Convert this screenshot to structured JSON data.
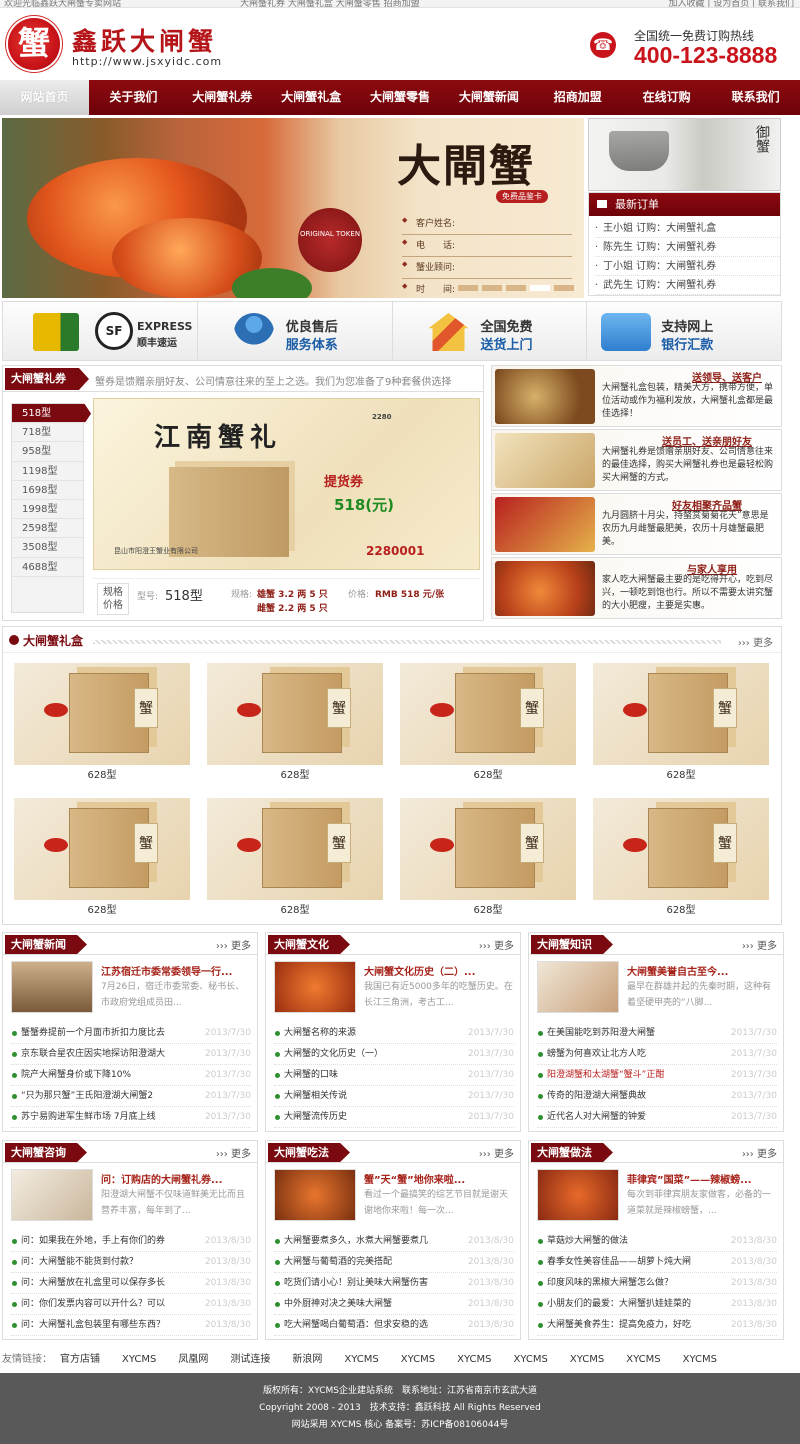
{
  "topbar": {
    "left": "欢迎光临鑫跃大闸蟹专卖网站",
    "center": "大闸蟹礼券 大闸蟹礼盒 大闸蟹零售 招商加盟",
    "right": "加入收藏 | 设为首页 | 联系我们"
  },
  "header": {
    "seal_char": "蟹",
    "logo_name": "鑫跃大闸蟹",
    "logo_url": "http://www.jsxyidc.com",
    "hotline_label": "全国统一免费订购热线",
    "hotline_number": "400-123-8888",
    "phone_icon": "phone-icon"
  },
  "nav": {
    "items": [
      "网站首页",
      "关于我们",
      "大闸蟹礼券",
      "大闸蟹礼盒",
      "大闸蟹零售",
      "大闸蟹新闻",
      "招商加盟",
      "在线订购",
      "联系我们"
    ],
    "active_index": 0
  },
  "banner": {
    "title": "大閘蟹",
    "subtitle": "免费品鉴卡",
    "seal_text": "ORIGINAL TOKEN",
    "form_fields": [
      "客户姓名:",
      "电　　话:",
      "蟹业顾问:",
      "时　　间:"
    ],
    "slides": 5,
    "active_slide": 4
  },
  "side": {
    "calligraphy": "御蟹",
    "orders_title": "最新订单",
    "orders": [
      "王小姐  订购：大闸蟹礼盒",
      "陈先生  订购：大闸蟹礼券",
      "丁小姐  订购：大闸蟹礼券",
      "武先生  订购：大闸蟹礼券"
    ]
  },
  "services": [
    {
      "t1": "EXPRESS",
      "t2": "顺丰速运",
      "icon": "sf-express-icon"
    },
    {
      "t1": "优良售后",
      "t2": "服务体系",
      "icon": "service-person-icon"
    },
    {
      "t1": "全国免费",
      "t2": "送货上门",
      "icon": "home-delivery-icon"
    },
    {
      "t1": "支持网上",
      "t2": "银行汇款",
      "icon": "bank-icon"
    }
  ],
  "coupon": {
    "tab": "大闸蟹礼券",
    "intro": "蟹券是馈赠亲朋好友、公司情意往来的至上之选。我们为您准备了9种套餐供选择",
    "sizes": [
      "518型",
      "718型",
      "958型",
      "1198型",
      "1698型",
      "1998型",
      "2598型",
      "3508型",
      "4688型"
    ],
    "active_size": 0,
    "voucher_brand": "江南蟹礼",
    "voucher_top": "2280",
    "voucher_tag": "提货券",
    "voucher_price": "518(元)",
    "voucher_serial": "2280001",
    "voucher_company": "昆山市阳澄王蟹业有限公司",
    "spec_label": "规格价格",
    "model_label": "型号:",
    "model_value": "518型",
    "spec_t": "规格:",
    "spec_v1": "雄蟹 3.2 两 5 只",
    "spec_v2": "雌蟹 2.2 两 5 只",
    "price_t": "价格:",
    "price_v": "RMB 518 元/张"
  },
  "promos": [
    {
      "title": "送领导、送客户",
      "text": "大闸蟹礼盒包装，精美大方，携带方便，单位活动或作为福利发放，大闸蟹礼盒都是最佳选择！"
    },
    {
      "title": "送员工、送亲朋好友",
      "text": "大闸蟹礼券是馈赠亲朋好友、公司情意往来的最佳选择，购买大闸蟹礼券也是最轻松购买大闸蟹的方式。"
    },
    {
      "title": "好友相聚齐品蟹",
      "text": "九月圆脐十月尖，持螯赏菊菊花天”意思是农历九月雌蟹最肥美，农历十月雄蟹最肥美。"
    },
    {
      "title": "与家人享用",
      "text": "家人吃大闸蟹最主要的是吃得开心，吃到尽兴，一顿吃到饱也行。所以不需要太讲究蟹的大小肥瘦，主要是实惠。"
    }
  ],
  "giftsec": {
    "title": "大闸蟹礼盒",
    "more": "更多",
    "items": [
      "628型",
      "628型",
      "628型",
      "628型",
      "628型",
      "628型",
      "628型",
      "628型"
    ],
    "box_char": "蟹"
  },
  "columns": [
    {
      "title": "大闸蟹新闻",
      "more": "更多",
      "feat_title": "江苏宿迁市委常委领导一行...",
      "feat_summary": "7月26日，宿迁市委常委、秘书长、市政府党组成员田...",
      "items": [
        {
          "t": "蟹蟹券提前一个月面市折扣力度比去",
          "d": "2013/7/30"
        },
        {
          "t": "京东联合星农庄因实地探访阳澄湖大",
          "d": "2013/7/30"
        },
        {
          "t": "院产大闸蟹身价或下降10%",
          "d": "2013/7/30"
        },
        {
          "t": "“只为那只蟹”王氏阳澄湖大闸蟹2",
          "d": "2013/7/30"
        },
        {
          "t": "苏宁易购进军生鲜市场 7月底上线",
          "d": "2013/7/30"
        }
      ]
    },
    {
      "title": "大闸蟹文化",
      "more": "更多",
      "feat_title": "大闸蟹文化历史（二）...",
      "feat_summary": "我国已有近5000多年的吃蟹历史。在长江三角洲，考古工...",
      "items": [
        {
          "t": "大闸蟹名称的来源",
          "d": "2013/7/30"
        },
        {
          "t": "大闸蟹的文化历史（一）",
          "d": "2013/7/30"
        },
        {
          "t": "大闸蟹的口味",
          "d": "2013/7/30"
        },
        {
          "t": "大闸蟹相关传说",
          "d": "2013/7/30"
        },
        {
          "t": "大闸蟹流传历史",
          "d": "2013/7/30"
        }
      ]
    },
    {
      "title": "大闸蟹知识",
      "more": "更多",
      "feat_title": "大闸蟹美誉自古至今...",
      "feat_summary": "最早在群雄并起的先秦时期，这种有着坚硬甲壳的“八脚...",
      "items": [
        {
          "t": "在美国能吃到苏阳澄大闸蟹",
          "d": "2013/7/30"
        },
        {
          "t": "螃蟹为何喜欢让北方人吃",
          "d": "2013/7/30"
        },
        {
          "t": "阳澄湖蟹和太湖蟹“蟹斗”正酣",
          "d": "2013/7/30",
          "red": true
        },
        {
          "t": "传奇的阳澄湖大闸蟹典故",
          "d": "2013/7/30"
        },
        {
          "t": "近代名人对大闸蟹的钟爱",
          "d": "2013/7/30"
        }
      ]
    },
    {
      "title": "大闸蟹咨询",
      "more": "更多",
      "feat_title": "问：订购店的大闸蟹礼券...",
      "feat_summary": "阳澄湖大闸蟹不仅味道鲜美无比而且营养丰富，每年到了...",
      "items": [
        {
          "t": "问：如果我在外地，手上有你们的券",
          "d": "2013/8/30"
        },
        {
          "t": "问：大闸蟹能不能货到付款？",
          "d": "2013/8/30"
        },
        {
          "t": "问：大闸蟹放在礼盒里可以保存多长",
          "d": "2013/8/30"
        },
        {
          "t": "问：你们发票内容可以开什么？可以",
          "d": "2013/8/30"
        },
        {
          "t": "问：大闸蟹礼盒包装里有哪些东西？",
          "d": "2013/8/30"
        }
      ]
    },
    {
      "title": "大闸蟹吃法",
      "more": "更多",
      "feat_title": "蟹”天“蟹”地你来啦...",
      "feat_summary": "看过一个最搞笑的综艺节目就是谢天谢地你来啦！每一次...",
      "items": [
        {
          "t": "大闸蟹要煮多久，水煮大闸蟹要煮几",
          "d": "2013/8/30"
        },
        {
          "t": "大闸蟹与葡萄酒的完美搭配",
          "d": "2013/8/30"
        },
        {
          "t": "吃货们请小心！别让美味大闸蟹伤害",
          "d": "2013/8/30"
        },
        {
          "t": "中外厨神对决之美味大闸蟹",
          "d": "2013/8/30"
        },
        {
          "t": "吃大闸蟹喝白葡萄酒：但求安稳的选",
          "d": "2013/8/30"
        }
      ]
    },
    {
      "title": "大闸蟹做法",
      "more": "更多",
      "feat_title": "菲律宾”国菜”——辣椒螃...",
      "feat_summary": "每次到菲律宾朋友家做客，必备的一道菜就是辣椒螃蟹，...",
      "items": [
        {
          "t": "草菇炒大闸蟹的做法",
          "d": "2013/8/30"
        },
        {
          "t": "春季女性美容佳品——胡萝卜炖大闸",
          "d": "2013/8/30"
        },
        {
          "t": "印度风味的黑椒大闸蟹怎么做？",
          "d": "2013/8/30"
        },
        {
          "t": "小朋友们的最爱：大闸蟹扒娃娃菜的",
          "d": "2013/8/30"
        },
        {
          "t": "大闸蟹美食养生：提高免疫力，好吃",
          "d": "2013/8/30"
        }
      ]
    }
  ],
  "links": {
    "label": "友情链接：",
    "items": [
      "官方店铺",
      "XYCMS",
      "凤凰网",
      "测试连接",
      "新浪网",
      "XYCMS",
      "XYCMS",
      "XYCMS",
      "XYCMS",
      "XYCMS",
      "XYCMS",
      "XYCMS"
    ]
  },
  "footer": {
    "line1": "版权所有：XYCMS企业建站系统　联系地址：江苏省南京市玄武大道",
    "line2": "Copyright 2008 - 2013　技术支持：鑫跃科技 All Rights Reserved",
    "line3": "网站采用 XYCMS 核心 备案号：苏ICP备08106044号"
  },
  "colors": {
    "brand": "#7a0a10",
    "hotline": "#c8141a",
    "price_green": "#1f8a1f"
  }
}
